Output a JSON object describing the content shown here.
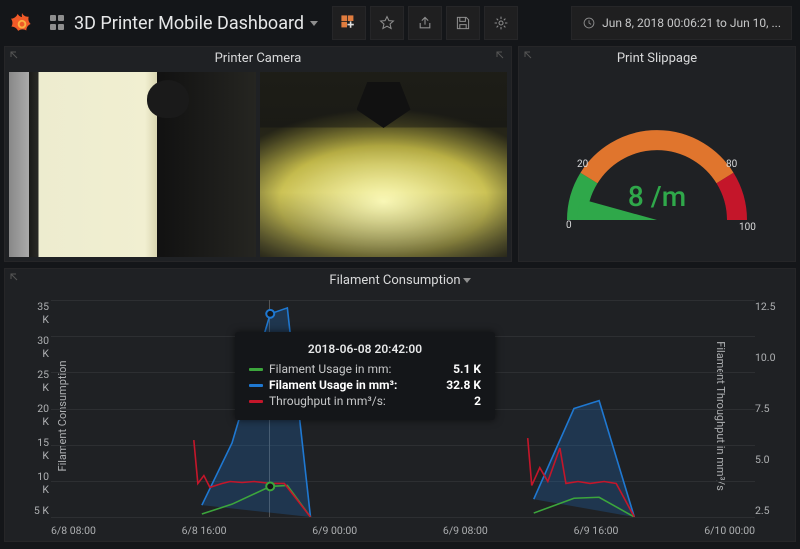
{
  "header": {
    "title": "3D Printer Mobile Dashboard",
    "timerange": "Jun 8, 2018 00:06:21 to Jun 10, ..."
  },
  "panels": {
    "camera": {
      "title": "Printer Camera"
    },
    "slippage": {
      "title": "Print Slippage",
      "value": "8 /m",
      "ticks": {
        "t0": "0",
        "t20": "20",
        "t80": "80",
        "t100": "100"
      }
    },
    "filament": {
      "title": "Filament Consumption",
      "ylabel_left": "Filament Consumption",
      "ylabel_right": "Filament Throughput in mm³/s",
      "yaxis_left": [
        "35 K",
        "30 K",
        "25 K",
        "20 K",
        "15 K",
        "10 K",
        "5 K"
      ],
      "yaxis_right": [
        "12.5",
        "",
        "10.0",
        "",
        "7.5",
        "",
        "5.0",
        "",
        "2.5",
        ""
      ],
      "xaxis": [
        "6/8 08:00",
        "6/8 16:00",
        "6/9 00:00",
        "6/9 08:00",
        "6/9 16:00",
        "6/10 00:00"
      ],
      "tooltip": {
        "time": "2018-06-08 20:42:00",
        "rows": [
          {
            "color": "#3ca63c",
            "label": "Filament Usage in mm:",
            "value": "5.1 K",
            "highlight": false
          },
          {
            "color": "#1f78d1",
            "label": "Filament Usage in mm³:",
            "value": "32.8 K",
            "highlight": true
          },
          {
            "color": "#c4162a",
            "label": "Throughput in mm³/s:",
            "value": "2",
            "highlight": false
          }
        ]
      }
    }
  },
  "chart_data": {
    "type": "line",
    "title": "Filament Consumption",
    "xlabel": "",
    "ylabel_left": "Filament Consumption",
    "ylabel_right": "Filament Throughput in mm³/s",
    "x_range": [
      "2018-06-08 00:06",
      "2018-06-10 00:06"
    ],
    "y_left_range": [
      0,
      35000
    ],
    "y_right_range": [
      0,
      12.5
    ],
    "x_ticks": [
      "6/8 08:00",
      "6/8 16:00",
      "6/9 00:00",
      "6/9 08:00",
      "6/9 16:00",
      "6/10 00:00"
    ],
    "series": [
      {
        "name": "Filament Usage in mm",
        "axis": "left",
        "color": "#3ca63c",
        "x": [
          "6/8 12:00",
          "6/8 16:00",
          "6/8 20:42",
          "6/8 22:00",
          "6/9 00:00",
          "6/9 13:00",
          "6/9 16:00",
          "6/9 17:00",
          "6/9 20:00"
        ],
        "y": [
          500,
          2200,
          5100,
          5300,
          0,
          600,
          3000,
          3200,
          0
        ]
      },
      {
        "name": "Filament Usage in mm³",
        "axis": "left",
        "color": "#1f78d1",
        "x": [
          "6/8 12:00",
          "6/8 16:00",
          "6/8 20:42",
          "6/8 22:00",
          "6/9 00:00",
          "6/9 13:00",
          "6/9 16:00",
          "6/9 17:00",
          "6/9 20:00"
        ],
        "y": [
          2000,
          12000,
          32800,
          34000,
          0,
          3000,
          18000,
          19000,
          0
        ]
      },
      {
        "name": "Throughput in mm³/s",
        "axis": "right",
        "color": "#c4162a",
        "x": [
          "6/8 11:30",
          "6/8 12:00",
          "6/8 13:00",
          "6/8 16:00",
          "6/8 20:42",
          "6/8 22:00",
          "6/9 00:00",
          "6/9 12:30",
          "6/9 13:00",
          "6/9 16:00",
          "6/9 17:00",
          "6/9 20:00"
        ],
        "y": [
          4.4,
          2.5,
          2.0,
          2.3,
          2.0,
          2.0,
          0,
          4.5,
          2.0,
          2.2,
          2.3,
          0
        ]
      }
    ]
  }
}
